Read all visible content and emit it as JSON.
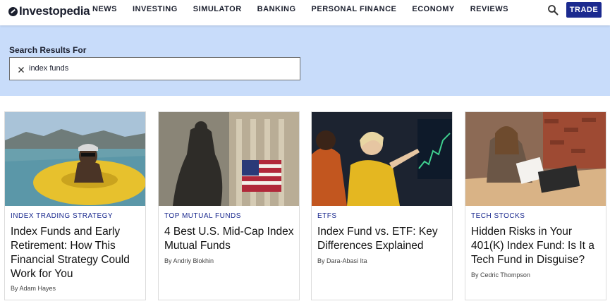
{
  "brand": {
    "name": "Investopedia"
  },
  "nav": {
    "items": [
      "NEWS",
      "INVESTING",
      "SIMULATOR",
      "BANKING",
      "PERSONAL FINANCE",
      "ECONOMY",
      "REVIEWS"
    ],
    "trade_label": "TRADE"
  },
  "search": {
    "label": "Search Results For",
    "query": "index funds"
  },
  "colors": {
    "brand_navy": "#1b2a8f",
    "search_band": "#c8dcfa",
    "tag_text": "#1b2a8f"
  },
  "icons": {
    "search": "magnifier-icon",
    "clear": "close-x-icon"
  },
  "results": [
    {
      "tag": "INDEX TRADING STRATEGY",
      "title": "Index Funds and Early Retirement: How This Financial Strategy Could Work for You",
      "byline": "By Adam Hayes"
    },
    {
      "tag": "TOP MUTUAL FUNDS",
      "title": "4 Best U.S. Mid-Cap Index Mutual Funds",
      "byline": "By Andriy Blokhin"
    },
    {
      "tag": "ETFS",
      "title": "Index Fund vs. ETF: Key Differences Explained",
      "byline": "By Dara-Abasi Ita"
    },
    {
      "tag": "TECH STOCKS",
      "title": "Hidden Risks in Your 401(K) Index Fund: Is It a Tech Fund in Disguise?",
      "byline": "By Cedric Thompson"
    }
  ]
}
